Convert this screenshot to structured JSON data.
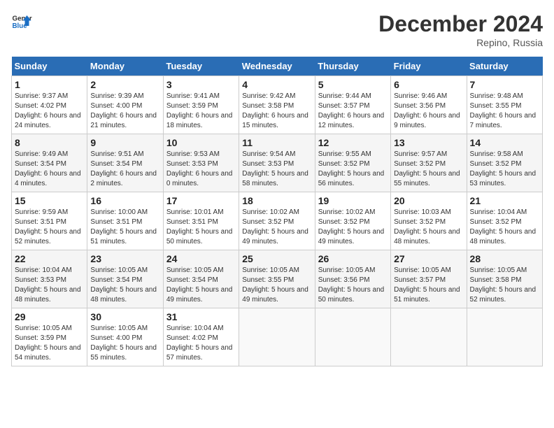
{
  "header": {
    "logo_general": "General",
    "logo_blue": "Blue",
    "month_year": "December 2024",
    "location": "Repino, Russia"
  },
  "weekdays": [
    "Sunday",
    "Monday",
    "Tuesday",
    "Wednesday",
    "Thursday",
    "Friday",
    "Saturday"
  ],
  "weeks": [
    [
      {
        "day": "1",
        "sunrise": "9:37 AM",
        "sunset": "4:02 PM",
        "daylight": "6 hours and 24 minutes."
      },
      {
        "day": "2",
        "sunrise": "9:39 AM",
        "sunset": "4:00 PM",
        "daylight": "6 hours and 21 minutes."
      },
      {
        "day": "3",
        "sunrise": "9:41 AM",
        "sunset": "3:59 PM",
        "daylight": "6 hours and 18 minutes."
      },
      {
        "day": "4",
        "sunrise": "9:42 AM",
        "sunset": "3:58 PM",
        "daylight": "6 hours and 15 minutes."
      },
      {
        "day": "5",
        "sunrise": "9:44 AM",
        "sunset": "3:57 PM",
        "daylight": "6 hours and 12 minutes."
      },
      {
        "day": "6",
        "sunrise": "9:46 AM",
        "sunset": "3:56 PM",
        "daylight": "6 hours and 9 minutes."
      },
      {
        "day": "7",
        "sunrise": "9:48 AM",
        "sunset": "3:55 PM",
        "daylight": "6 hours and 7 minutes."
      }
    ],
    [
      {
        "day": "8",
        "sunrise": "9:49 AM",
        "sunset": "3:54 PM",
        "daylight": "6 hours and 4 minutes."
      },
      {
        "day": "9",
        "sunrise": "9:51 AM",
        "sunset": "3:54 PM",
        "daylight": "6 hours and 2 minutes."
      },
      {
        "day": "10",
        "sunrise": "9:53 AM",
        "sunset": "3:53 PM",
        "daylight": "6 hours and 0 minutes."
      },
      {
        "day": "11",
        "sunrise": "9:54 AM",
        "sunset": "3:53 PM",
        "daylight": "5 hours and 58 minutes."
      },
      {
        "day": "12",
        "sunrise": "9:55 AM",
        "sunset": "3:52 PM",
        "daylight": "5 hours and 56 minutes."
      },
      {
        "day": "13",
        "sunrise": "9:57 AM",
        "sunset": "3:52 PM",
        "daylight": "5 hours and 55 minutes."
      },
      {
        "day": "14",
        "sunrise": "9:58 AM",
        "sunset": "3:52 PM",
        "daylight": "5 hours and 53 minutes."
      }
    ],
    [
      {
        "day": "15",
        "sunrise": "9:59 AM",
        "sunset": "3:51 PM",
        "daylight": "5 hours and 52 minutes."
      },
      {
        "day": "16",
        "sunrise": "10:00 AM",
        "sunset": "3:51 PM",
        "daylight": "5 hours and 51 minutes."
      },
      {
        "day": "17",
        "sunrise": "10:01 AM",
        "sunset": "3:51 PM",
        "daylight": "5 hours and 50 minutes."
      },
      {
        "day": "18",
        "sunrise": "10:02 AM",
        "sunset": "3:52 PM",
        "daylight": "5 hours and 49 minutes."
      },
      {
        "day": "19",
        "sunrise": "10:02 AM",
        "sunset": "3:52 PM",
        "daylight": "5 hours and 49 minutes."
      },
      {
        "day": "20",
        "sunrise": "10:03 AM",
        "sunset": "3:52 PM",
        "daylight": "5 hours and 48 minutes."
      },
      {
        "day": "21",
        "sunrise": "10:04 AM",
        "sunset": "3:52 PM",
        "daylight": "5 hours and 48 minutes."
      }
    ],
    [
      {
        "day": "22",
        "sunrise": "10:04 AM",
        "sunset": "3:53 PM",
        "daylight": "5 hours and 48 minutes."
      },
      {
        "day": "23",
        "sunrise": "10:05 AM",
        "sunset": "3:54 PM",
        "daylight": "5 hours and 48 minutes."
      },
      {
        "day": "24",
        "sunrise": "10:05 AM",
        "sunset": "3:54 PM",
        "daylight": "5 hours and 49 minutes."
      },
      {
        "day": "25",
        "sunrise": "10:05 AM",
        "sunset": "3:55 PM",
        "daylight": "5 hours and 49 minutes."
      },
      {
        "day": "26",
        "sunrise": "10:05 AM",
        "sunset": "3:56 PM",
        "daylight": "5 hours and 50 minutes."
      },
      {
        "day": "27",
        "sunrise": "10:05 AM",
        "sunset": "3:57 PM",
        "daylight": "5 hours and 51 minutes."
      },
      {
        "day": "28",
        "sunrise": "10:05 AM",
        "sunset": "3:58 PM",
        "daylight": "5 hours and 52 minutes."
      }
    ],
    [
      {
        "day": "29",
        "sunrise": "10:05 AM",
        "sunset": "3:59 PM",
        "daylight": "5 hours and 54 minutes."
      },
      {
        "day": "30",
        "sunrise": "10:05 AM",
        "sunset": "4:00 PM",
        "daylight": "5 hours and 55 minutes."
      },
      {
        "day": "31",
        "sunrise": "10:04 AM",
        "sunset": "4:02 PM",
        "daylight": "5 hours and 57 minutes."
      },
      null,
      null,
      null,
      null
    ]
  ]
}
